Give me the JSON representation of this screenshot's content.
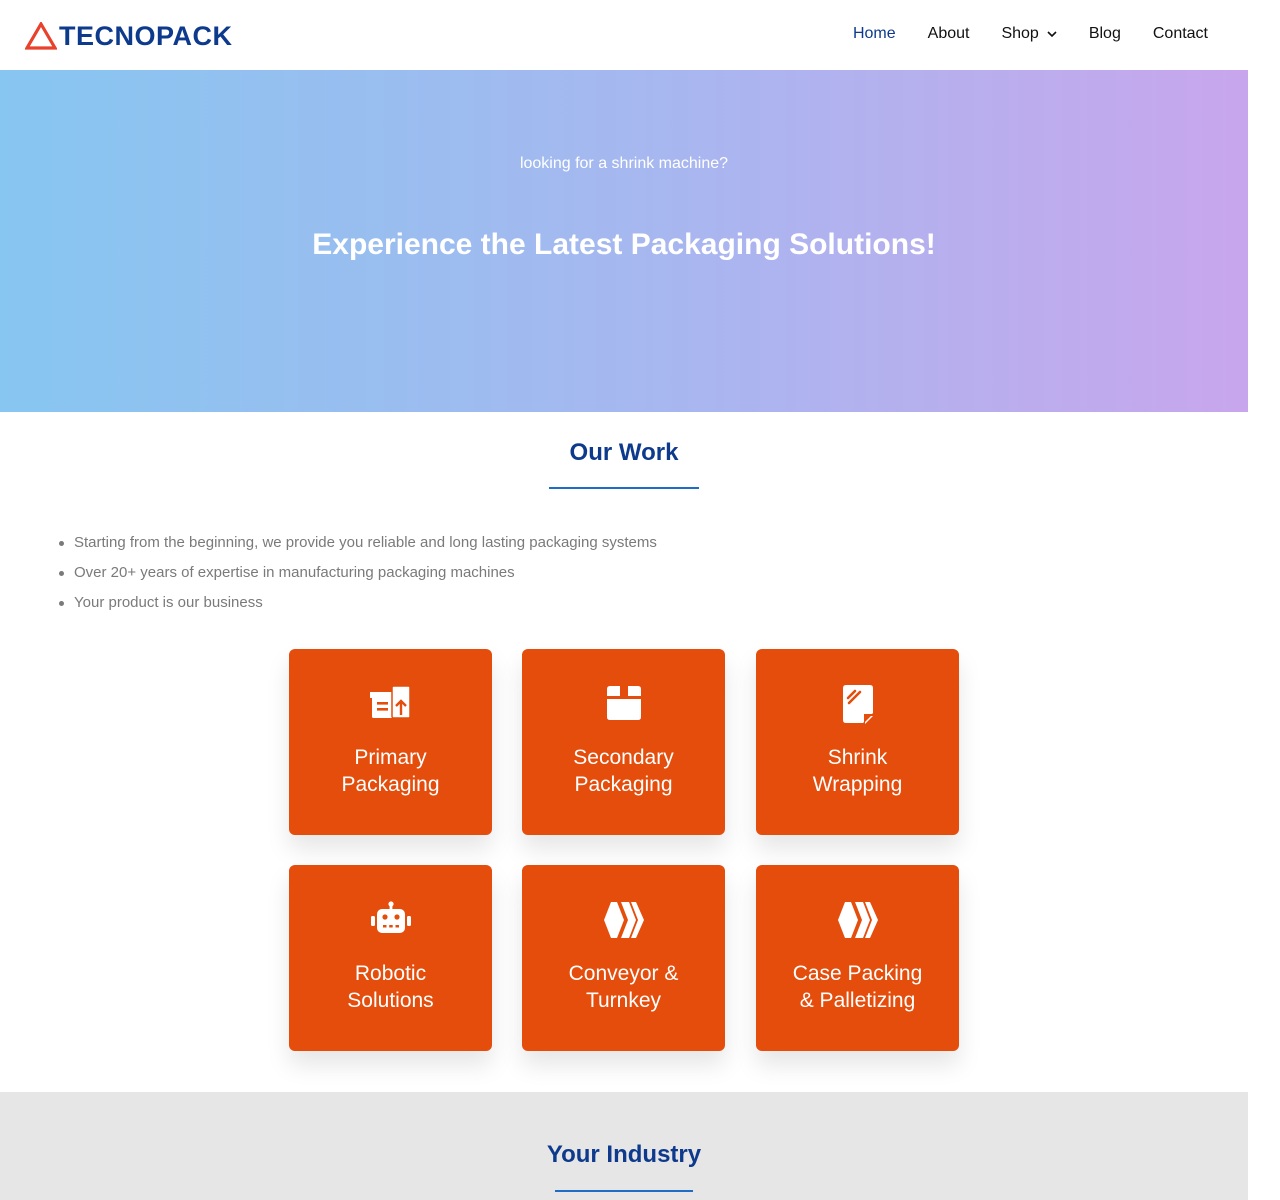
{
  "header": {
    "logo_text": "TECNOPACK",
    "nav": {
      "home": "Home",
      "about": "About",
      "shop": "Shop",
      "blog": "Blog",
      "contact": "Contact"
    }
  },
  "hero": {
    "subtitle": "looking for a shrink machine?",
    "title": "Experience the Latest Packaging Solutions!"
  },
  "our_work": {
    "title": "Our Work",
    "bullets": [
      "Starting from the beginning, we provide you reliable and long lasting packaging systems",
      "Over 20+ years of expertise in manufacturing packaging machines",
      "Your product is our business"
    ],
    "cards": [
      {
        "line1": "Primary",
        "line2": "Packaging",
        "icon": "boxes-icon"
      },
      {
        "line1": "Secondary",
        "line2": "Packaging",
        "icon": "box-icon"
      },
      {
        "line1": "Shrink",
        "line2": "Wrapping",
        "icon": "note-icon"
      },
      {
        "line1": "Robotic",
        "line2": "Solutions",
        "icon": "robot-icon"
      },
      {
        "line1": "Conveyor &",
        "line2": "Turnkey",
        "icon": "hive-icon"
      },
      {
        "line1": "Case Packing",
        "line2": "& Palletizing",
        "icon": "hive-icon"
      }
    ]
  },
  "industry": {
    "title": "Your Industry"
  },
  "colors": {
    "brand_blue": "#0d3a8c",
    "accent_orange": "#e44d0b",
    "logo_red": "#e8412c"
  }
}
